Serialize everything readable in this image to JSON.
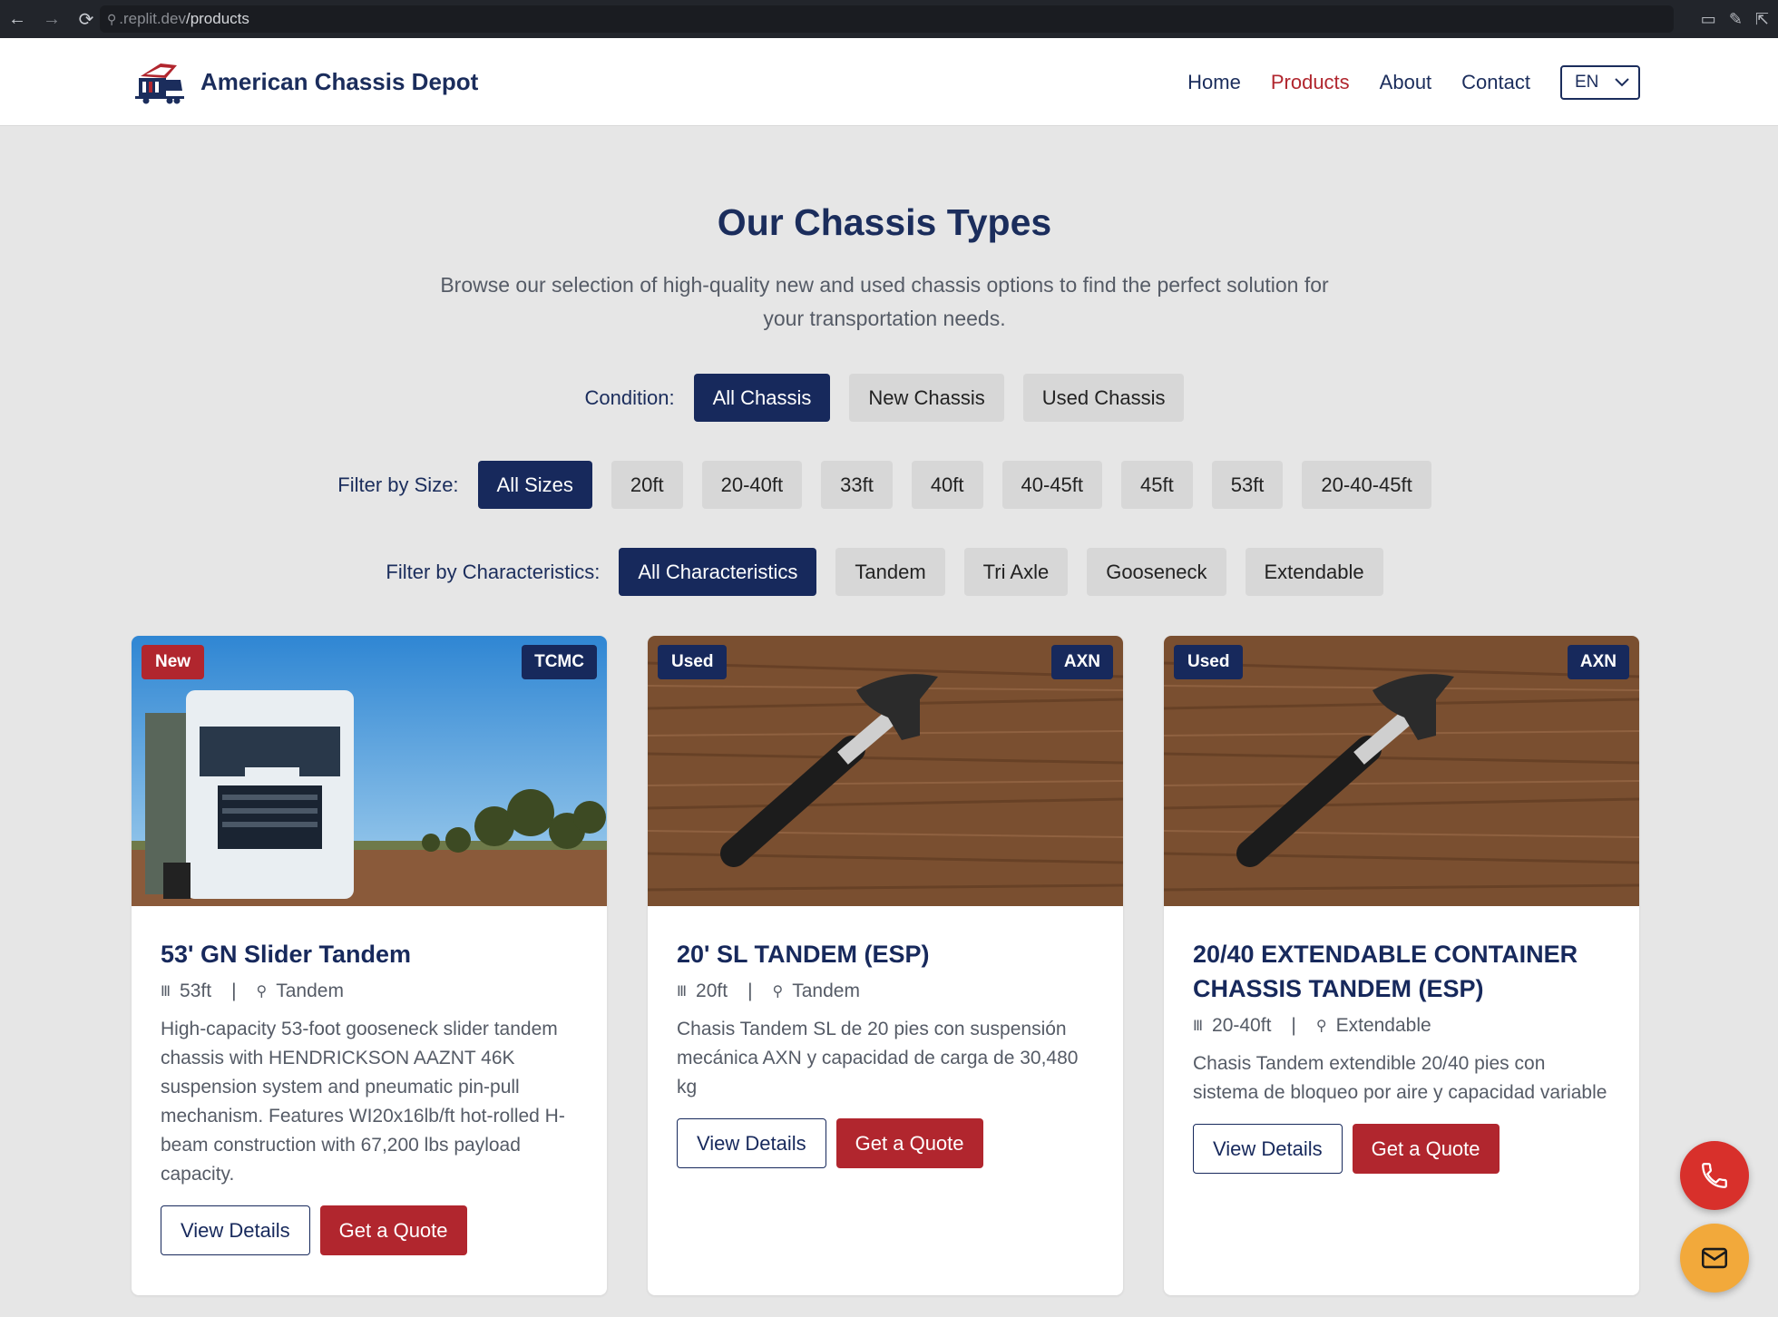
{
  "browser": {
    "url_prefix": ".replit.dev",
    "url_path": "/products"
  },
  "header": {
    "brand": "American Chassis Depot",
    "nav": [
      "Home",
      "Products",
      "About",
      "Contact"
    ],
    "language": "EN"
  },
  "hero": {
    "title": "Our Chassis Types",
    "subtitle": "Browse our selection of high-quality new and used chassis options to find the perfect solution for your transportation needs."
  },
  "filters": {
    "condition": {
      "label": "Condition:",
      "options": [
        "All Chassis",
        "New Chassis",
        "Used Chassis"
      ]
    },
    "size": {
      "label": "Filter by Size:",
      "options": [
        "All Sizes",
        "20ft",
        "20-40ft",
        "33ft",
        "40ft",
        "40-45ft",
        "45ft",
        "53ft",
        "20-40-45ft"
      ]
    },
    "characteristics": {
      "label": "Filter by Characteristics:",
      "options": [
        "All Characteristics",
        "Tandem",
        "Tri Axle",
        "Gooseneck",
        "Extendable"
      ]
    }
  },
  "products": [
    {
      "condition": "New",
      "brand": "TCMC",
      "title": "53' GN Slider Tandem",
      "size": "53ft",
      "type": "Tandem",
      "description": "High-capacity 53-foot gooseneck slider tandem chassis with HENDRICKSON AAZNT 46K suspension system and pneumatic pin-pull mechanism. Features WI20x16lb/ft hot-rolled H-beam construction with 67,200 lbs payload capacity.",
      "view_label": "View Details",
      "quote_label": "Get a Quote"
    },
    {
      "condition": "Used",
      "brand": "AXN",
      "title": "20' SL TANDEM (ESP)",
      "size": "20ft",
      "type": "Tandem",
      "description": "Chasis Tandem SL de 20 pies con suspensión mecánica AXN y capacidad de carga de 30,480 kg",
      "view_label": "View Details",
      "quote_label": "Get a Quote"
    },
    {
      "condition": "Used",
      "brand": "AXN",
      "title": "20/40 EXTENDABLE CONTAINER CHASSIS TANDEM (ESP)",
      "size": "20-40ft",
      "type": "Extendable",
      "description": "Chasis Tandem extendible 20/40 pies con sistema de bloqueo por aire y capacidad variable",
      "view_label": "View Details",
      "quote_label": "Get a Quote"
    }
  ],
  "colors": {
    "navy": "#17295c",
    "red": "#b1262e",
    "phone_fab": "#d8302b",
    "mail_fab": "#f2a93b"
  },
  "icons": {
    "phone": "phone-icon",
    "mail": "mail-icon",
    "size": "ruler-icon",
    "type": "axle-icon"
  }
}
